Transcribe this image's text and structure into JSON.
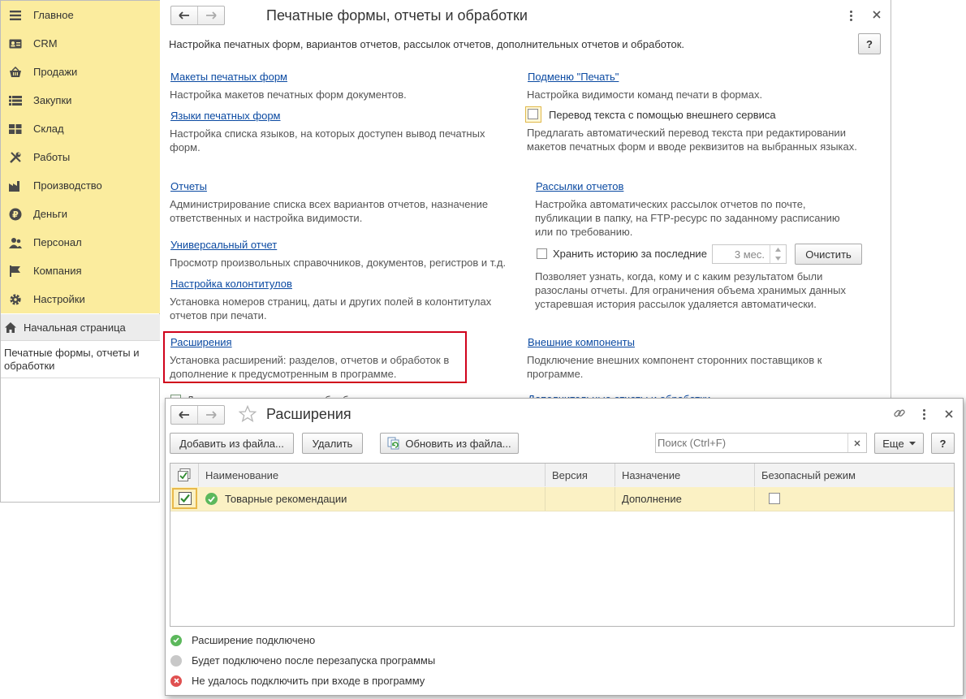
{
  "sidebar": {
    "items": [
      {
        "label": "Главное",
        "icon": "menu-icon"
      },
      {
        "label": "CRM",
        "icon": "crm-card-icon"
      },
      {
        "label": "Продажи",
        "icon": "sales-basket-icon"
      },
      {
        "label": "Закупки",
        "icon": "purchases-icon"
      },
      {
        "label": "Склад",
        "icon": "warehouse-icon"
      },
      {
        "label": "Работы",
        "icon": "works-tools-icon"
      },
      {
        "label": "Производство",
        "icon": "factory-icon"
      },
      {
        "label": "Деньги",
        "icon": "ruble-icon"
      },
      {
        "label": "Персонал",
        "icon": "staff-icon"
      },
      {
        "label": "Компания",
        "icon": "flag-icon"
      },
      {
        "label": "Настройки",
        "icon": "gear-icon"
      }
    ],
    "home_label": "Начальная страница",
    "open_tab_label": "Печатные формы, отчеты и обработки"
  },
  "main": {
    "title": "Печатные формы, отчеты и обработки",
    "subtitle": "Настройка печатных форм, вариантов отчетов, рассылок отчетов, дополнительных отчетов и обработок.",
    "help_label": "?",
    "left": {
      "layouts_link": "Макеты печатных форм",
      "layouts_desc": "Настройка макетов печатных форм документов.",
      "languages_link": "Языки печатных форм",
      "languages_desc": "Настройка списка языков, на которых доступен вывод печатных форм.",
      "reports_link": "Отчеты",
      "reports_desc": "Администрирование списка всех вариантов отчетов, назначение ответственных и настройка видимости.",
      "universal_link": "Универсальный отчет",
      "universal_desc": "Просмотр произвольных справочников, документов, регистров и т.д.",
      "headers_link": "Настройка колонтитулов",
      "headers_desc": "Установка номеров страниц, даты и других полей в колонтитулах отчетов при печати.",
      "extensions_link": "Расширения",
      "extensions_desc": "Установка расширений: разделов, отчетов и обработок в дополнение к предусмотренным в программе.",
      "additional_partial": "Дополнительные отчеты и обработки"
    },
    "right": {
      "print_submenu_link": "Подменю \"Печать\"",
      "print_submenu_desc": "Настройка видимости команд печати в формах.",
      "translate_label": "Перевод текста с помощью внешнего сервиса",
      "translate_desc": "Предлагать автоматический перевод текста при редактировании макетов печатных форм и вводе реквизитов на выбранных языках.",
      "mailing_link": "Рассылки отчетов",
      "mailing_desc": "Настройка автоматических рассылок отчетов по почте, публикации в папку, на FTP-ресурс по заданному расписанию или по требованию.",
      "history_label": "Хранить историю за последние",
      "history_value": "3 мес.",
      "clear_button": "Очистить",
      "history_desc": "Позволяет узнать, когда, кому и с каким результатом были разосланы отчеты. Для ограничения объема хранимых данных устаревшая история рассылок удаляется автоматически.",
      "external_link": "Внешние компоненты",
      "external_desc": "Подключение внешних компонент сторонних поставщиков к программе.",
      "additional_partial": "Дополнительные отчеты и обработки"
    }
  },
  "extensions": {
    "title": "Расширения",
    "toolbar": {
      "add_from_file": "Добавить из файла...",
      "delete": "Удалить",
      "update_from_file": "Обновить из файла...",
      "search_placeholder": "Поиск (Ctrl+F)",
      "more": "Еще",
      "help": "?"
    },
    "columns": [
      "Наименование",
      "Версия",
      "Назначение",
      "Безопасный режим"
    ],
    "rows": [
      {
        "checked": true,
        "status": "connected",
        "name": "Товарные рекомендации",
        "version": "",
        "purpose": "Дополнение",
        "safe_mode": false
      }
    ],
    "legend": [
      {
        "status": "connected",
        "text": "Расширение подключено",
        "color": "#5cb85c"
      },
      {
        "status": "pending",
        "text": "Будет подключено после перезапуска программы",
        "color": "#c8c8c8"
      },
      {
        "status": "failed",
        "text": "Не удалось подключить при входе в программу",
        "color": "#e05050"
      }
    ]
  },
  "colors": {
    "sidebar_bg": "#fbec9e",
    "link": "#0b4aa2",
    "highlight_frame": "#d0021b",
    "selected_row": "#fbf1c4"
  }
}
